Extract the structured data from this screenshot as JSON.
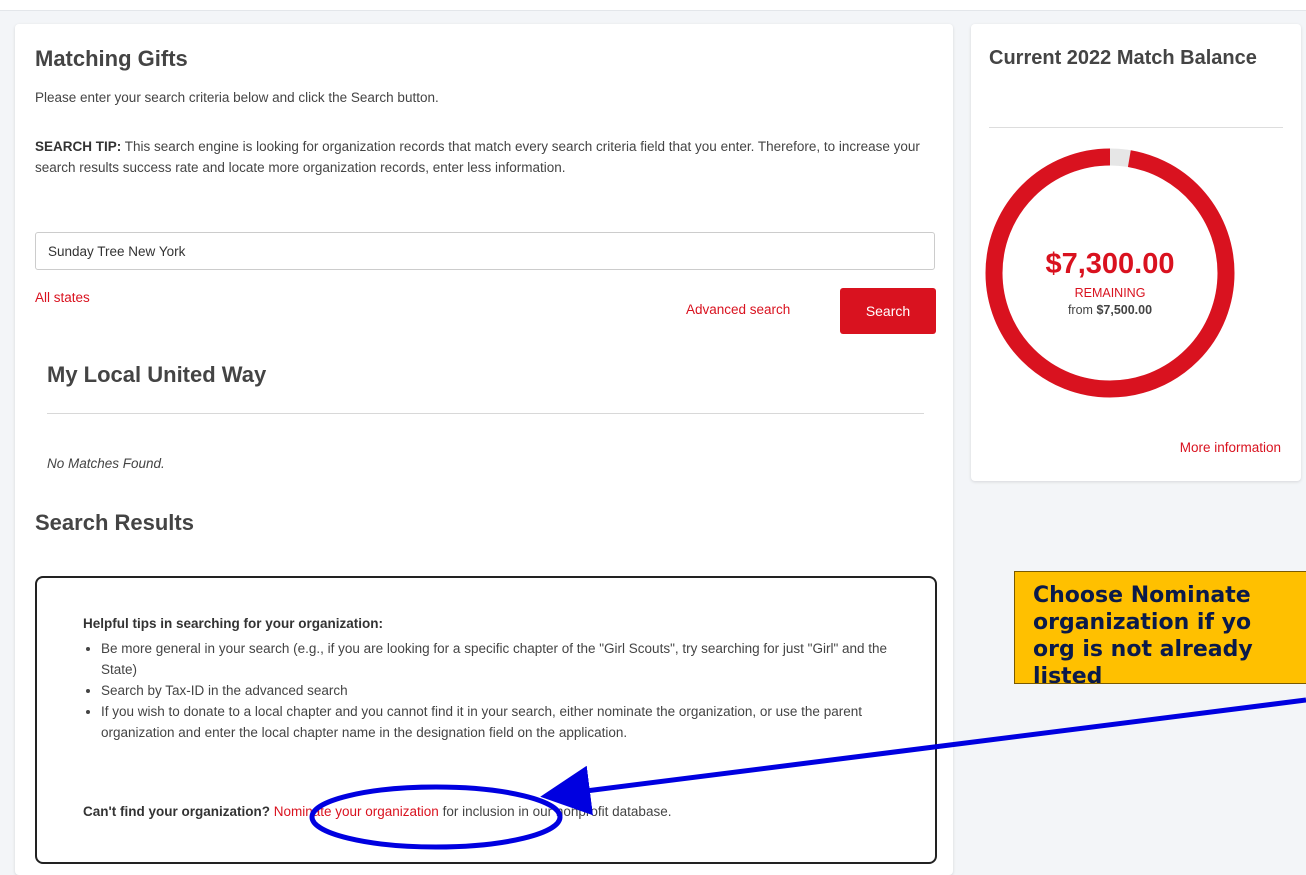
{
  "main": {
    "title": "Matching Gifts",
    "intro": "Please enter your search criteria below and click the Search button.",
    "tip_label": "SEARCH TIP:",
    "tip_text": " This search engine is looking for organization records that match every search criteria field that you enter. Therefore, to increase your search results success rate and locate more organization records, enter less information.",
    "search_value": "Sunday Tree New York",
    "all_states": "All states",
    "advanced_search": "Advanced search",
    "search_button": "Search",
    "local_title": "My Local United Way",
    "no_matches": "No Matches Found.",
    "results_title": "Search Results",
    "tips_heading": "Helpful tips in searching for your organization:",
    "tips": [
      "Be more general in your search (e.g., if you are looking for a specific chapter of the \"Girl Scouts\", try searching for just \"Girl\" and the State)",
      "Search by Tax-ID in the advanced search",
      "If you wish to donate to a local chapter and you cannot find it in your search, either nominate the organization, or use the parent organization and enter the local chapter name in the designation field on the application."
    ],
    "cant_find_label": "Can't find your organization?",
    "nominate_link": "Nominate your organization",
    "cant_find_suffix": " for inclusion in our nonprofit database."
  },
  "side": {
    "title": "Current 2022 Match Balance",
    "amount": "$7,300.00",
    "remaining_label": "REMAINING",
    "from_prefix": "from ",
    "from_amount": "$7,500.00",
    "remaining_fraction": 0.9733,
    "more_info": "More information",
    "accent_color": "#d9121f",
    "track_color": "#e6e6e6"
  },
  "annotation": {
    "callout_lines": [
      "Choose Nominate",
      "organization if yo",
      "org is not already",
      "listed"
    ],
    "callout_color": "#ffc000",
    "arrow_color": "#0000e0"
  }
}
